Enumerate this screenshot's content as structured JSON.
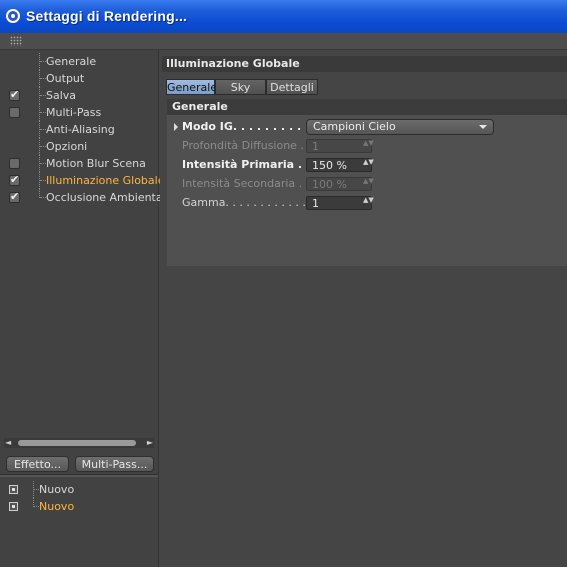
{
  "window": {
    "title": "Settaggi di Rendering..."
  },
  "sidebar": {
    "items": [
      {
        "label": "Generale",
        "checkbox": "none",
        "active": false
      },
      {
        "label": "Output",
        "checkbox": "none",
        "active": false
      },
      {
        "label": "Salva",
        "checkbox": "checked",
        "active": false
      },
      {
        "label": "Multi-Pass",
        "checkbox": "unchecked",
        "active": false
      },
      {
        "label": "Anti-Aliasing",
        "checkbox": "none",
        "active": false
      },
      {
        "label": "Opzioni",
        "checkbox": "none",
        "active": false
      },
      {
        "label": "Motion Blur Scena",
        "checkbox": "unchecked",
        "active": false
      },
      {
        "label": "Illuminazione Globale",
        "checkbox": "checked",
        "active": true
      },
      {
        "label": "Occlusione Ambientale",
        "checkbox": "checked",
        "active": false
      }
    ],
    "check_mark": "✔",
    "effetto_button": "Effetto...",
    "multipass_button": "Multi-Pass...",
    "presets": [
      {
        "label": "Nuovo",
        "active": false
      },
      {
        "label": "Nuovo",
        "active": true
      }
    ],
    "scroll_left": "◄",
    "scroll_right": "►"
  },
  "panel": {
    "section_title": "Illuminazione Globale",
    "tabs": [
      {
        "label": "Generale",
        "active": true
      },
      {
        "label": "Sky",
        "active": false
      },
      {
        "label": "Dettagli",
        "active": false
      }
    ],
    "group_title": "Generale",
    "props": {
      "modo": {
        "label": "Modo IG. . . . . . . . . . . .",
        "value": "Campioni Cielo"
      },
      "profondita": {
        "label": "Profondità Diffusione . . .",
        "value": "1"
      },
      "intensita_primaria": {
        "label": "Intensità Primaria . . .",
        "value": "150 %"
      },
      "intensita_secondaria": {
        "label": "Intensità Secondaria . . .",
        "value": "100 %"
      },
      "gamma": {
        "label": "Gamma. . . . . . . . . . . . . . .",
        "value": "1"
      }
    },
    "spinner_glyph": "▲▼"
  },
  "colors": {
    "accent_active": "#ffb53c",
    "titlebar_blue": "#0a4bd2",
    "tab_active": "#8eabd4"
  }
}
